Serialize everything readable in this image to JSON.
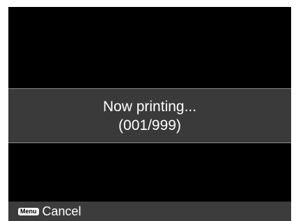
{
  "status": {
    "line1": "Now printing...",
    "line2": "(001/999)"
  },
  "footer": {
    "menu_key_label": "Menu",
    "cancel_label": "Cancel"
  },
  "colors": {
    "screen_background": "#000000",
    "band_background": "#3a3a3a",
    "footer_background": "#3c3c3c",
    "text": "#ffffff"
  }
}
